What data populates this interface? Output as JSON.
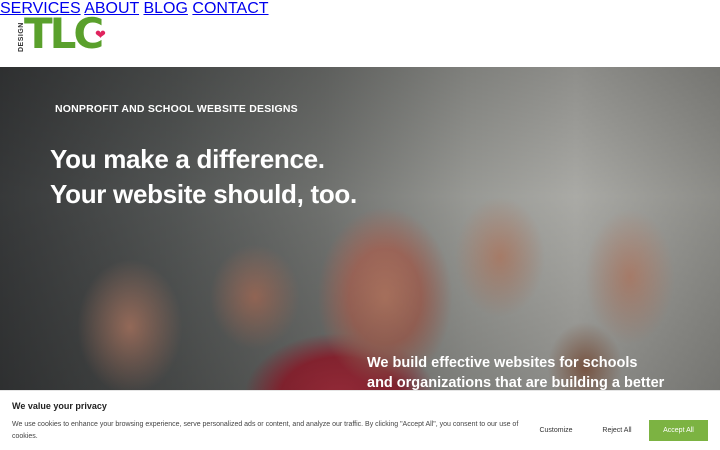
{
  "logo": {
    "design_text": "DESIGN",
    "brand_text": "TLC",
    "heart_icon": "heart-icon",
    "brand_color": "#5aa02c",
    "heart_color": "#e0245e"
  },
  "nav": {
    "items": [
      {
        "label": "SERVICES"
      },
      {
        "label": "ABOUT"
      },
      {
        "label": "BLOG"
      },
      {
        "label": "CONTACT"
      }
    ]
  },
  "hero": {
    "eyebrow": "NONPROFIT AND SCHOOL WEBSITE DESIGNS",
    "headline_line1": "You make a difference.",
    "headline_line2": "Your website should, too.",
    "subtext": "We build effective websites for schools and organizations that are building a better"
  },
  "cookie_banner": {
    "title": "We value your privacy",
    "body": "We use cookies to enhance your browsing experience, serve personalized ads or content, and analyze our traffic. By clicking \"Accept All\", you consent to our use of cookies.",
    "customize_label": "Customize",
    "reject_label": "Reject All",
    "accept_label": "Accept All",
    "accept_color": "#7cb342"
  }
}
